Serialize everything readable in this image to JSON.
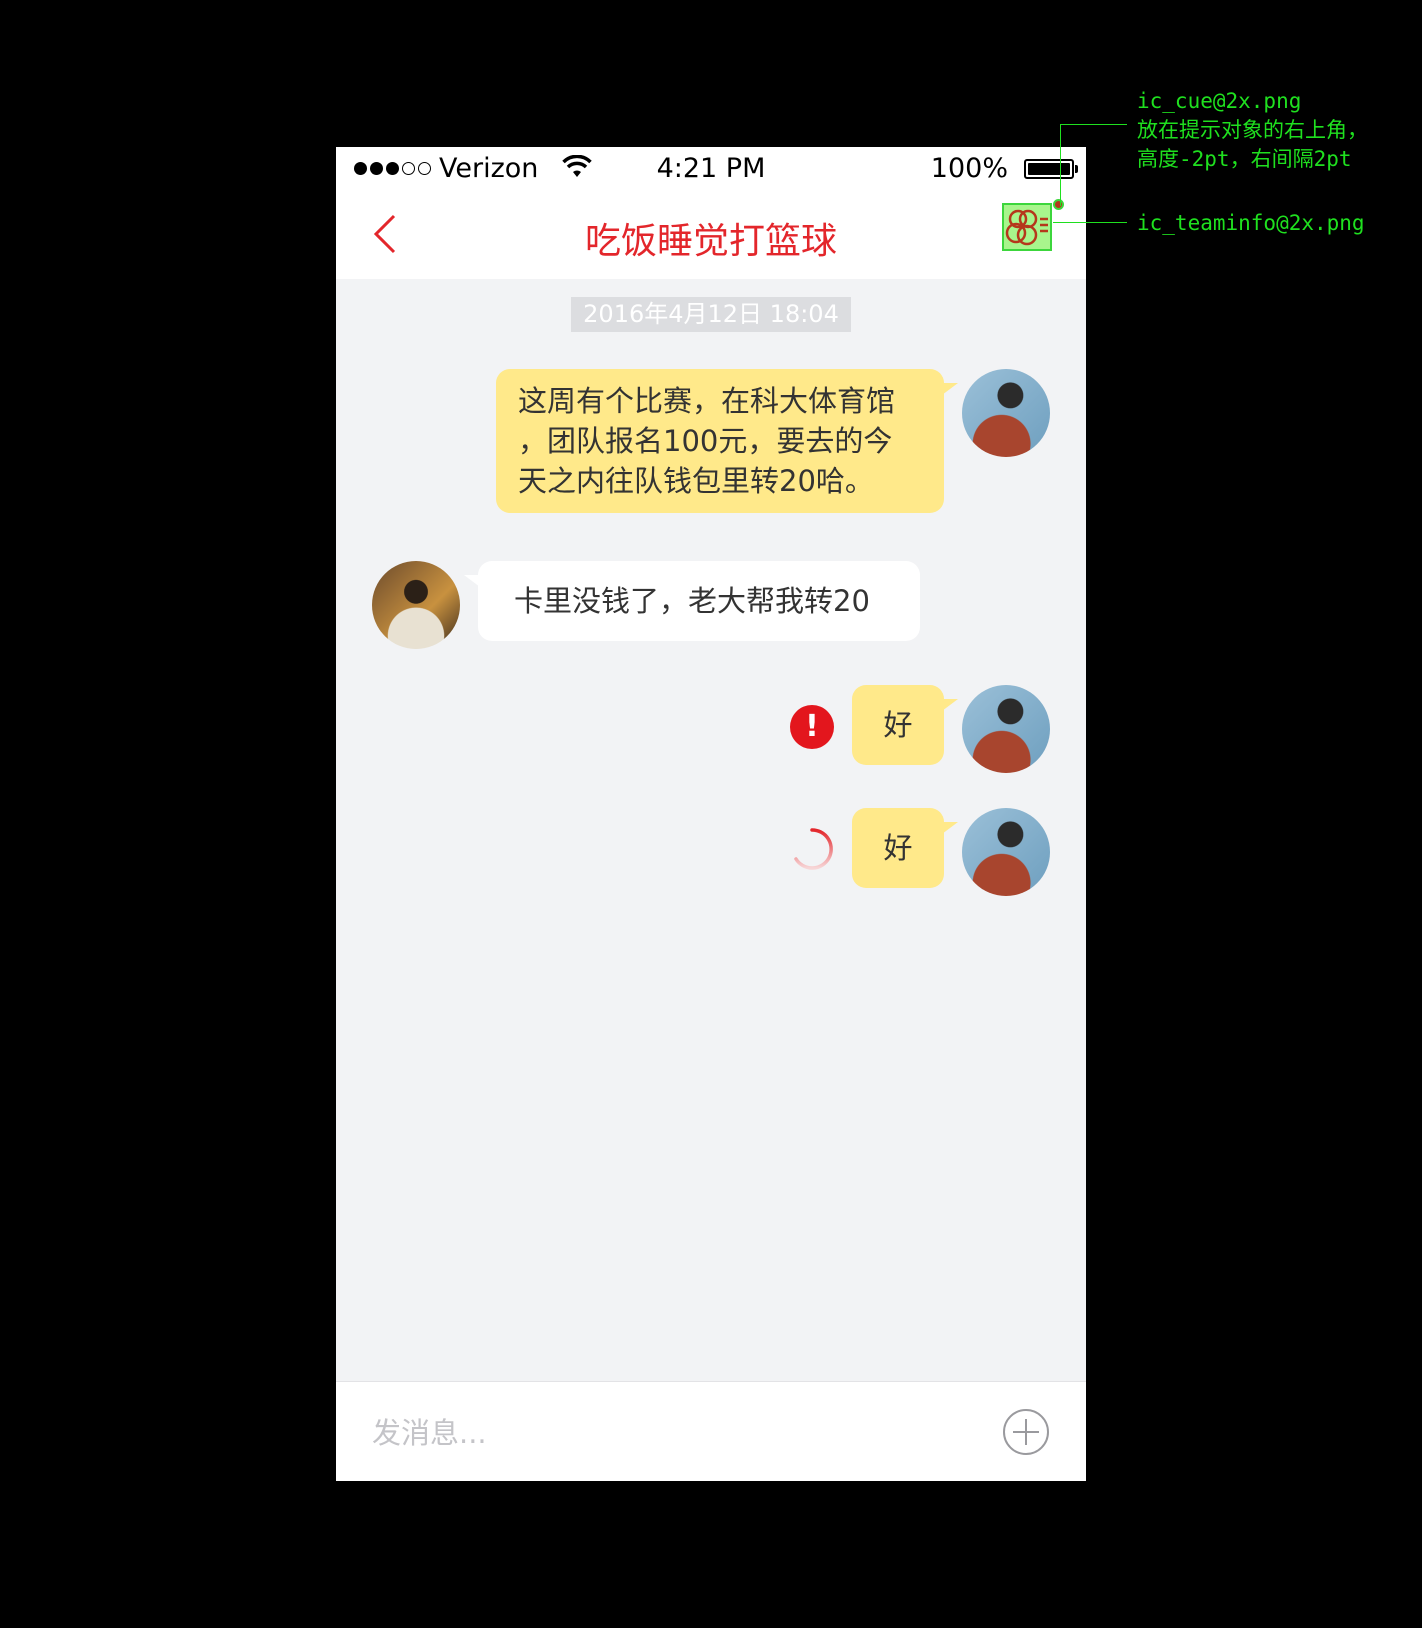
{
  "status_bar": {
    "carrier": "Verizon",
    "time": "4:21 PM",
    "battery": "100%"
  },
  "nav": {
    "title": "吃饭睡觉打篮球",
    "back_icon": "chevron-left-icon",
    "teaminfo_icon": "team-info-icon"
  },
  "chat": {
    "timestamp": "2016年4月12日 18:04",
    "messages": [
      {
        "side": "right",
        "text_lines": [
          "这周有个比赛，在科大体育馆",
          "，团队报名100元，要去的今",
          "天之内往队钱包里转20哈。"
        ],
        "status": ""
      },
      {
        "side": "left",
        "text": "卡里没钱了，老大帮我转20",
        "status": ""
      },
      {
        "side": "right",
        "text": "好",
        "status": "failed"
      },
      {
        "side": "right",
        "text": "好",
        "status": "sending"
      }
    ]
  },
  "input": {
    "placeholder": "发消息...",
    "add_icon": "plus-circle-icon"
  },
  "annotations": {
    "cue_lines": [
      "ic_cue@2x.png",
      "放在提示对象的右上角，",
      "高度-2pt，右间隔2pt"
    ],
    "teaminfo_label": "ic_teaminfo@2x.png"
  },
  "colors": {
    "accent": "#e3262b",
    "bubble_self": "#ffe98a",
    "bubble_other": "#ffffff",
    "background": "#f2f3f5",
    "annotation": "#1fe01f"
  }
}
